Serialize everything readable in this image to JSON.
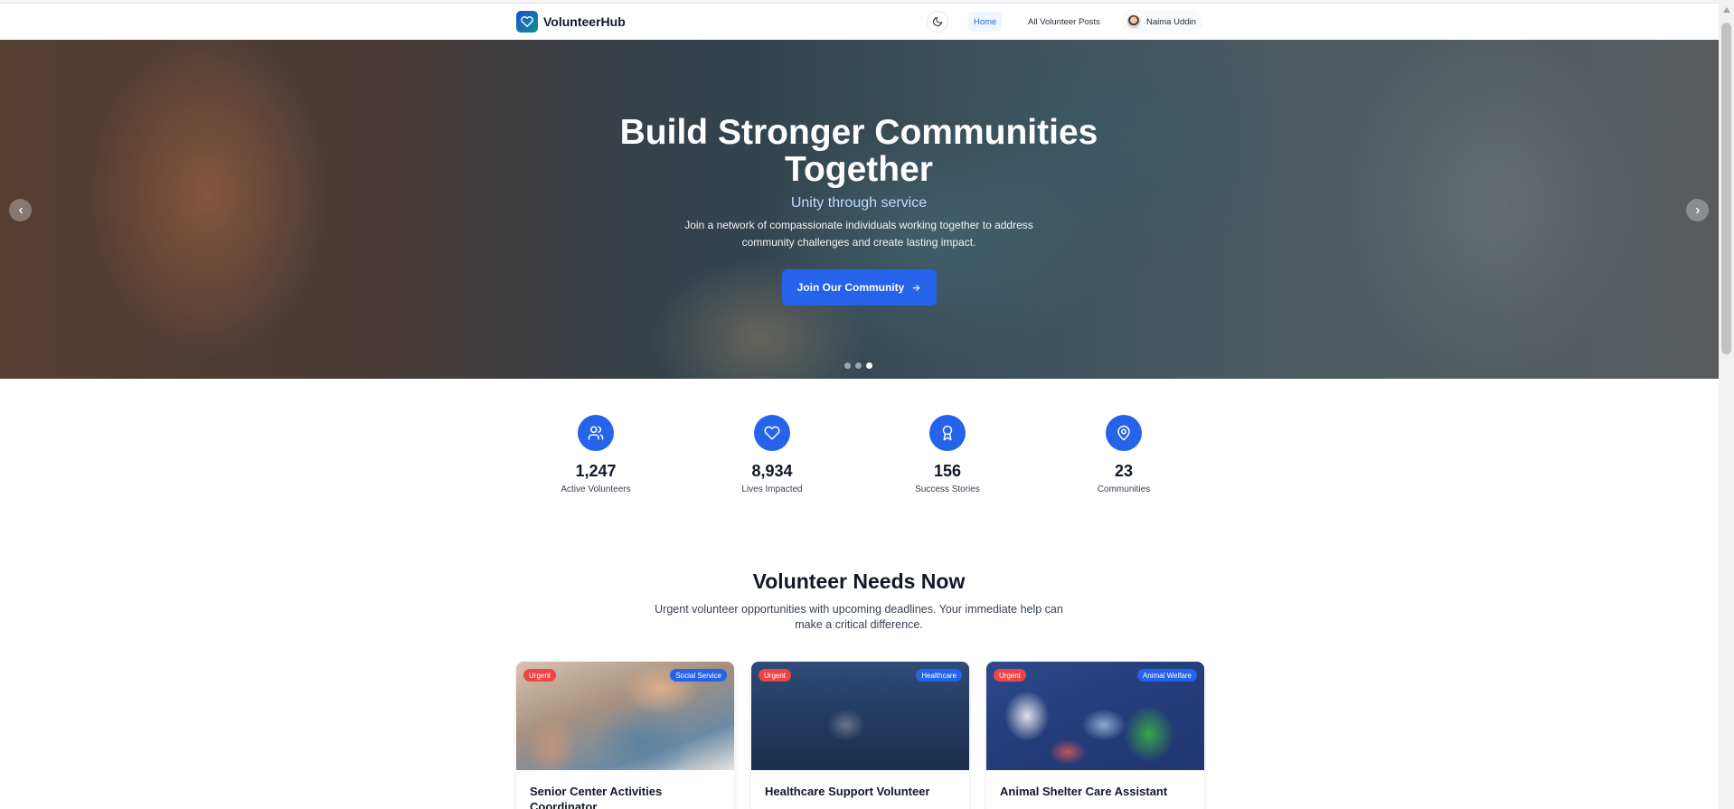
{
  "nav": {
    "brand": "VolunteerHub",
    "home": "Home",
    "all_posts": "All Volunteer Posts",
    "user_name": "Naima Uddin"
  },
  "hero": {
    "title": "Build Stronger Communities Together",
    "subtitle": "Unity through service",
    "description": "Join a network of compassionate individuals working together to address community challenges and create lasting impact.",
    "cta": "Join Our Community",
    "slide_count": 3,
    "active_slide": 3
  },
  "stats": [
    {
      "icon": "users-icon",
      "value": "1,247",
      "label": "Active Volunteers"
    },
    {
      "icon": "heart-icon",
      "value": "8,934",
      "label": "Lives Impacted"
    },
    {
      "icon": "award-icon",
      "value": "156",
      "label": "Success Stories"
    },
    {
      "icon": "map-pin-icon",
      "value": "23",
      "label": "Communities"
    }
  ],
  "section": {
    "title": "Volunteer Needs Now",
    "description": "Urgent volunteer opportunities with upcoming deadlines. Your immediate help can make a critical difference."
  },
  "cards": [
    {
      "badge": "Urgent",
      "category": "Social Service",
      "title": "Senior Center Activities Coordinator"
    },
    {
      "badge": "Urgent",
      "category": "Healthcare",
      "title": "Healthcare Support Volunteer"
    },
    {
      "badge": "Urgent",
      "category": "Animal Welfare",
      "title": "Animal Shelter Care Assistant"
    }
  ],
  "colors": {
    "primary": "#2563eb",
    "urgent": "#ef4444",
    "hero_subtitle": "#bfdbfe"
  }
}
